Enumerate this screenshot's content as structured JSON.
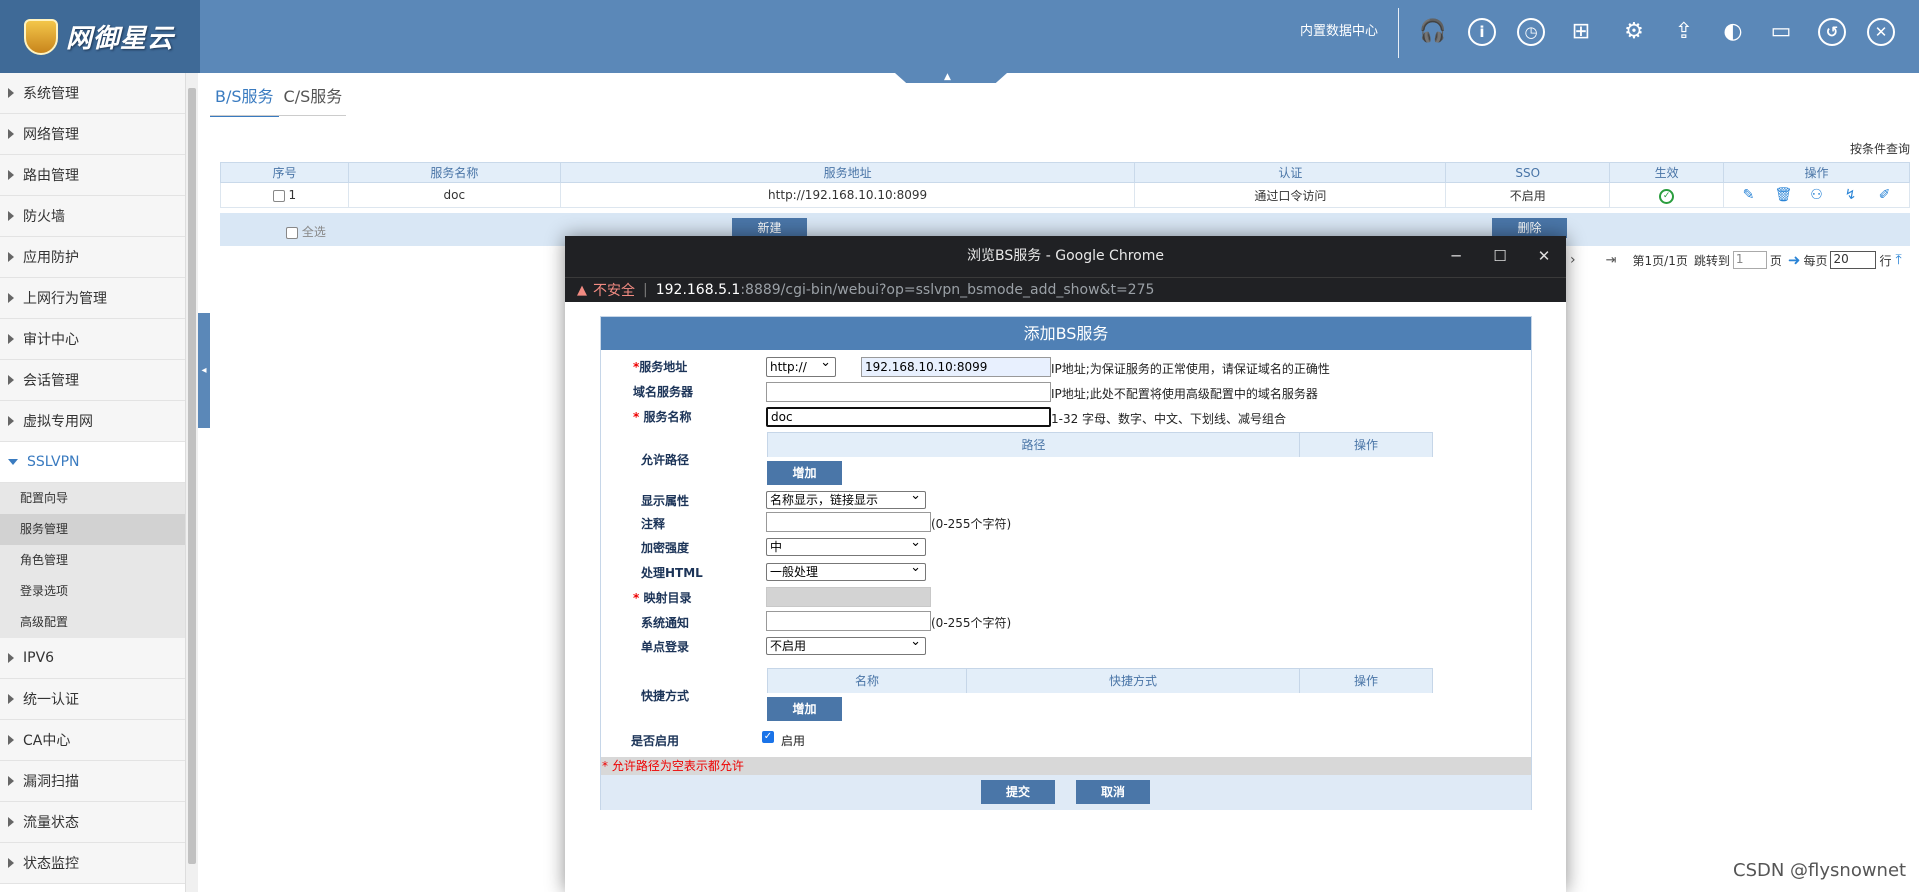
{
  "header": {
    "logo_text": "网御星云",
    "data_center": "内置数据中心",
    "icons": [
      "headset-icon",
      "info-icon",
      "dial-icon",
      "box-icon",
      "settings-upload-icon",
      "export-icon",
      "palette-icon",
      "chat-icon",
      "undo-icon",
      "close-icon"
    ]
  },
  "sidebar": {
    "items": [
      {
        "label": "系统管理"
      },
      {
        "label": "网络管理"
      },
      {
        "label": "路由管理"
      },
      {
        "label": "防火墙"
      },
      {
        "label": "应用防护"
      },
      {
        "label": "上网行为管理"
      },
      {
        "label": "审计中心"
      },
      {
        "label": "会话管理"
      },
      {
        "label": "虚拟专用网"
      },
      {
        "label": "SSLVPN"
      }
    ],
    "subitems": [
      "配置向导",
      "服务管理",
      "角色管理",
      "登录选项",
      "高级配置"
    ],
    "active_sub": "服务管理",
    "items_after": [
      {
        "label": "IPV6"
      },
      {
        "label": "统一认证"
      },
      {
        "label": "CA中心"
      },
      {
        "label": "漏洞扫描"
      },
      {
        "label": "流量状态"
      },
      {
        "label": "状态监控"
      }
    ]
  },
  "main": {
    "tabs": [
      "B/S服务",
      "C/S服务"
    ],
    "cond_query": "按条件查询",
    "table": {
      "headers": [
        "序号",
        "服务名称",
        "服务地址",
        "认证",
        "SSO",
        "生效",
        "操作"
      ],
      "rows": [
        {
          "index": "1",
          "name": "doc",
          "address": "http://192.168.10.10:8099",
          "auth": "通过口令访问",
          "sso": "不启用"
        }
      ]
    },
    "select_all": "全选",
    "new_button": "新建",
    "delete_button": "删除",
    "pager": {
      "page_info": "第1页/1页",
      "jump_label": "跳转到",
      "jump_value": "1",
      "page_word": "页",
      "per_page_label": "每页",
      "per_page_value": "20",
      "row_word": "行"
    }
  },
  "popup": {
    "title": "浏览BS服务 - Google Chrome",
    "insecure": "不安全",
    "url_host": "192.168.5.1",
    "url_rest": ":8889/cgi-bin/webui?op=sslvpn_bsmode_add_show&t=275",
    "form": {
      "heading": "添加BS服务",
      "service_address_label": "服务地址",
      "protocol_value": "http://",
      "address_value": "192.168.10.10:8099",
      "address_hint": "IP地址;为保证服务的正常使用，请保证域名的正确性",
      "dns_label": "域名服务器",
      "dns_value": "",
      "dns_hint": "IP地址;此处不配置将使用高级配置中的域名服务器",
      "name_label": "服务名称",
      "name_value": "doc",
      "name_hint": "1-32 字母、数字、中文、下划线、减号组合",
      "allow_path_label": "允许路径",
      "path_col": "路径",
      "op_col": "操作",
      "add_button": "增加",
      "display_label": "显示属性",
      "display_value": "名称显示，链接显示",
      "comment_label": "注释",
      "comment_hint": "(0-255个字符)",
      "encrypt_label": "加密强度",
      "encrypt_value": "中",
      "html_label": "处理HTML",
      "html_value": "一般处理",
      "map_label": "映射目录",
      "notify_label": "系统通知",
      "notify_hint": "(0-255个字符)",
      "sso_label": "单点登录",
      "sso_value": "不启用",
      "shortcut_label": "快捷方式",
      "sc_name_col": "名称",
      "sc_method_col": "快捷方式",
      "sc_op_col": "操作",
      "sc_add_button": "增加",
      "enable_label": "是否启用",
      "enable_text": "启用",
      "note": "* 允许路径为空表示都允许",
      "submit_button": "提交",
      "cancel_button": "取消"
    }
  },
  "watermark": "CSDN @flysnownet"
}
